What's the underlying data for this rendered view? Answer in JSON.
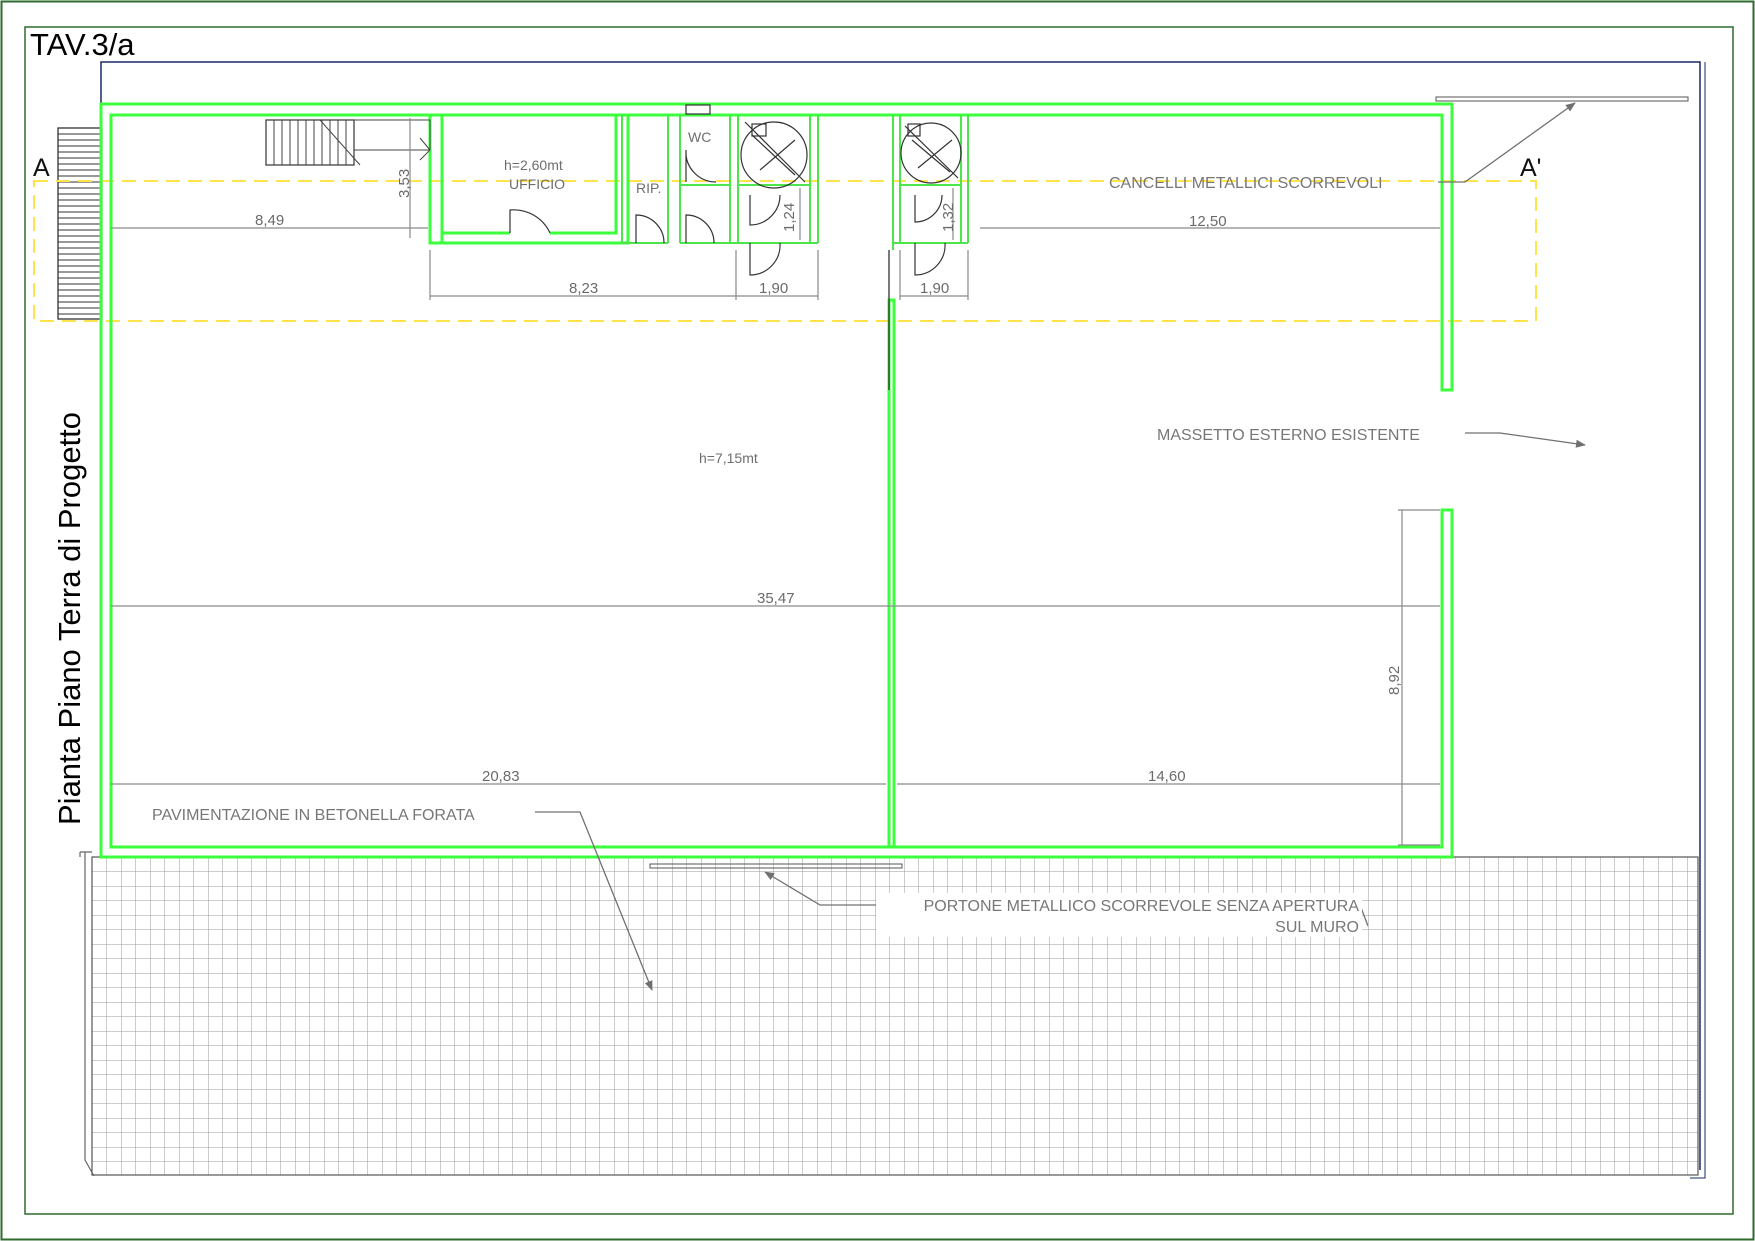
{
  "sheet": {
    "code": "TAV.3/a",
    "title": "Pianta Piano Terra di Progetto",
    "section_start": "A",
    "section_end": "A'"
  },
  "rooms": {
    "office_height": "h=2,60mt",
    "office_name": "UFFICIO",
    "storage": "RIP.",
    "wc": "WC",
    "hall_height": "h=7,15mt"
  },
  "dimensions": {
    "d_8_49": "8,49",
    "d_3_53": "3,53",
    "d_8_23": "8,23",
    "d_1_90_a": "1,90",
    "d_1_90_b": "1,90",
    "d_1_24": "1,24",
    "d_1_32": "1,32",
    "d_12_50": "12,50",
    "d_35_47": "35,47",
    "d_20_83": "20,83",
    "d_14_60": "14,60",
    "d_8_92": "8,92"
  },
  "annotations": {
    "gates": "CANCELLI METALLICI SCORREVOLI",
    "screed": "MASSETTO ESTERNO ESISTENTE",
    "paving": "PAVIMENTAZIONE IN BETONELLA  FORATA",
    "door_line1": "PORTONE METALLICO SCORREVOLE SENZA APERTURA",
    "door_line2": "SUL MURO"
  },
  "colors": {
    "wall": "#3cff3c",
    "frame": "#2e6b2e",
    "site_boundary": "#1a2a6b",
    "section_line": "#ffe34d",
    "dimension": "#8a8a8a",
    "paving_grid": "#9a9a9a"
  }
}
